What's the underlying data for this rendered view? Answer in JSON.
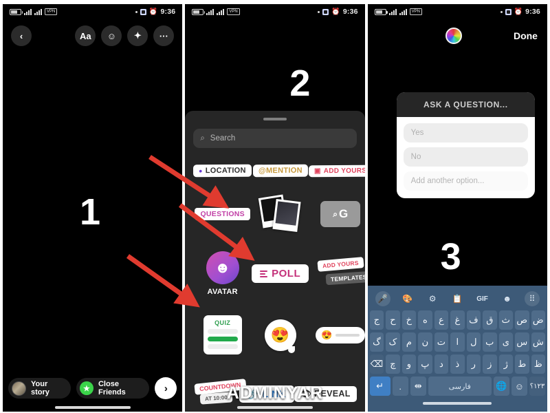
{
  "status_bar": {
    "time": "9:36",
    "vpn_label": "VPN"
  },
  "annotations": {
    "num1": "1",
    "num2": "2",
    "num3": "3"
  },
  "watermark": {
    "text": "ADMINYAR"
  },
  "panel1": {
    "toolbar": {
      "back_icon": "chevron-left-icon",
      "text_label": "Aa",
      "sticker_icon": "sticker-face-icon",
      "effects_icon": "sparkles-icon",
      "more_icon": "more-options-icon"
    },
    "bottom": {
      "your_story": "Your story",
      "close_friends": "Close Friends",
      "next_icon": "chevron-right-icon",
      "star_glyph": "★"
    }
  },
  "panel2": {
    "search": {
      "placeholder": "Search",
      "icon": "search-icon"
    },
    "stickers": {
      "location": "LOCATION",
      "mention": "@MENTION",
      "add_yours": "ADD YOURS",
      "questions": "QUESTIONS",
      "photos": "photo-stickers",
      "gif": "G",
      "avatar": "AVATAR",
      "poll": "POLL",
      "templates_top": "ADD YOURS",
      "templates_bottom": "TEMPLATES",
      "quiz": "QUIZ",
      "emoji_reaction": "😍",
      "emoji_slider": "😍",
      "countdown_top": "COUNTDOWN",
      "countdown_bottom": "AT 10:00",
      "link": "LINK",
      "reveal": "REVEAL"
    }
  },
  "panel3": {
    "header": {
      "color_wheel": "color-wheel-icon",
      "done": "Done"
    },
    "question_sticker": {
      "title": "ASK A QUESTION...",
      "option1": "Yes",
      "option2": "No",
      "option_add": "Add another option..."
    },
    "keyboard": {
      "toolbar": [
        "mic-icon",
        "palette-icon",
        "gear-icon",
        "clipboard-icon",
        "GIF",
        "sticker-icon",
        "grid-icon"
      ],
      "row1": [
        "ض",
        "ص",
        "ث",
        "ق",
        "ف",
        "غ",
        "ع",
        "ه",
        "خ",
        "ح",
        "ج"
      ],
      "row1_sup": [
        "",
        "١",
        "٢",
        "٣",
        "٤",
        "٥",
        "٦",
        "٧",
        "٨",
        "٩",
        "٠"
      ],
      "row2": [
        "ش",
        "س",
        "ی",
        "ب",
        "ل",
        "ا",
        "ت",
        "ن",
        "م",
        "ک",
        "گ"
      ],
      "row3": [
        "ظ",
        "ط",
        "ژ",
        "ز",
        "ر",
        "ذ",
        "د",
        "پ",
        "و",
        "چ",
        "⌫"
      ],
      "num_key": "۱۲۳؟",
      "emoji_key": "emoji-icon",
      "globe_key": "globe-icon",
      "space_key": "فارسی",
      "arrows_key": "cursor-arrows-icon",
      "period_key": ".",
      "enter_key": "↵"
    }
  },
  "colors": {
    "accent_red": "#e0445e",
    "arrow_red": "#e03b2f",
    "tray_bg": "#262626",
    "keyboard_bg": "#3d5a78",
    "green": "#22a94b"
  }
}
